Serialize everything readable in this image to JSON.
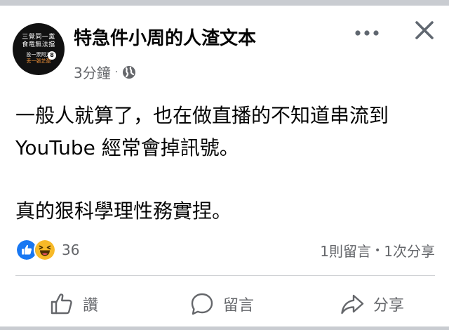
{
  "post": {
    "page_name": "特急件小周的人渣文本",
    "time": "3分鐘",
    "meta_separator": "·",
    "privacy_icon": "globe-icon",
    "avatar": {
      "line1": "三覺同一黨",
      "line2": "食竜無法擋",
      "line3": "投一票阿力",
      "line4": "丢一張芷盈",
      "badge": "8"
    },
    "text_lines": [
      "一般人就算了，也在做直播的不知道串流到",
      "YouTube 經常會掉訊號。",
      "真的狠科學理性務實捏。"
    ]
  },
  "header_actions": {
    "more_icon": "more-horizontal-icon",
    "close_icon": "close-icon"
  },
  "engagement": {
    "reaction_icons": [
      "like-reaction-icon",
      "haha-reaction-icon"
    ],
    "reaction_count": "36",
    "comments": "1則留言",
    "separator": "•",
    "shares": "1次分享"
  },
  "action_bar": {
    "like_label": "讚",
    "comment_label": "留言",
    "share_label": "分享"
  },
  "colors": {
    "text_primary": "#050505",
    "text_secondary": "#65676b",
    "like_blue": "#1877f2",
    "haha_yellow": "#f7b928",
    "divider": "#ced0d4"
  }
}
